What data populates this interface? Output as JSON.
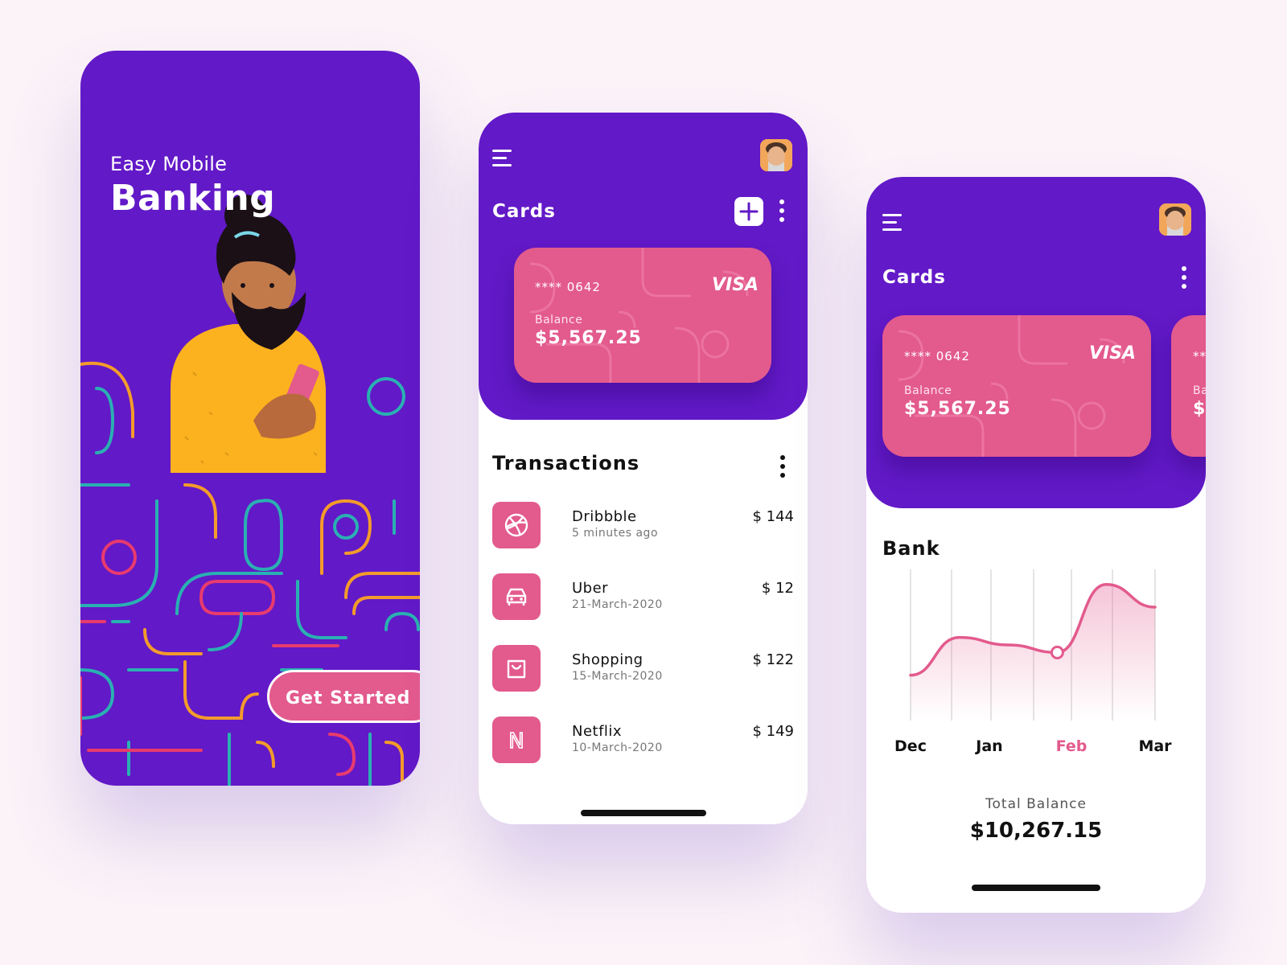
{
  "onboarding": {
    "subtitle": "Easy Mobile",
    "title": "Banking",
    "cta_label": "Get Started"
  },
  "cards_screen": {
    "header_title": "Cards",
    "card": {
      "number": "**** 0642",
      "network": "VISA",
      "balance_label": "Balance",
      "balance": "$5,567.25"
    },
    "transactions_title": "Transactions",
    "transactions": [
      {
        "name": "Dribbble",
        "subtitle": "5 minutes ago",
        "amount": "$ 144",
        "icon": "dribbble-icon"
      },
      {
        "name": "Uber",
        "subtitle": "21-March-2020",
        "amount": "$ 12",
        "icon": "car-icon"
      },
      {
        "name": "Shopping",
        "subtitle": "15-March-2020",
        "amount": "$ 122",
        "icon": "shopping-bag-icon"
      },
      {
        "name": "Netflix",
        "subtitle": "10-March-2020",
        "amount": "$ 149",
        "icon": "netflix-icon",
        "glyph": "N"
      }
    ]
  },
  "bank_screen": {
    "header_title": "Cards",
    "card": {
      "number": "**** 0642",
      "network": "VISA",
      "balance_label": "Balance",
      "balance": "$5,567.25"
    },
    "peek_card": {
      "number": "**",
      "balance_label": "Ba",
      "balance": "$"
    },
    "section_title": "Bank",
    "total_label": "Total Balance",
    "total_value": "$10,267.15"
  },
  "chart_data": {
    "type": "area",
    "categories": [
      "Dec",
      "Jan",
      "Feb",
      "Mar"
    ],
    "highlighted_category": "Feb",
    "grid": "vertical",
    "series": [
      {
        "values": [
          0.3,
          0.55,
          0.5,
          0.45,
          0.9,
          0.75
        ]
      }
    ]
  },
  "colors": {
    "purple": "#6219c7",
    "pink": "#e35a8d",
    "background": "#fbf3f8",
    "text_dark": "#111111"
  }
}
